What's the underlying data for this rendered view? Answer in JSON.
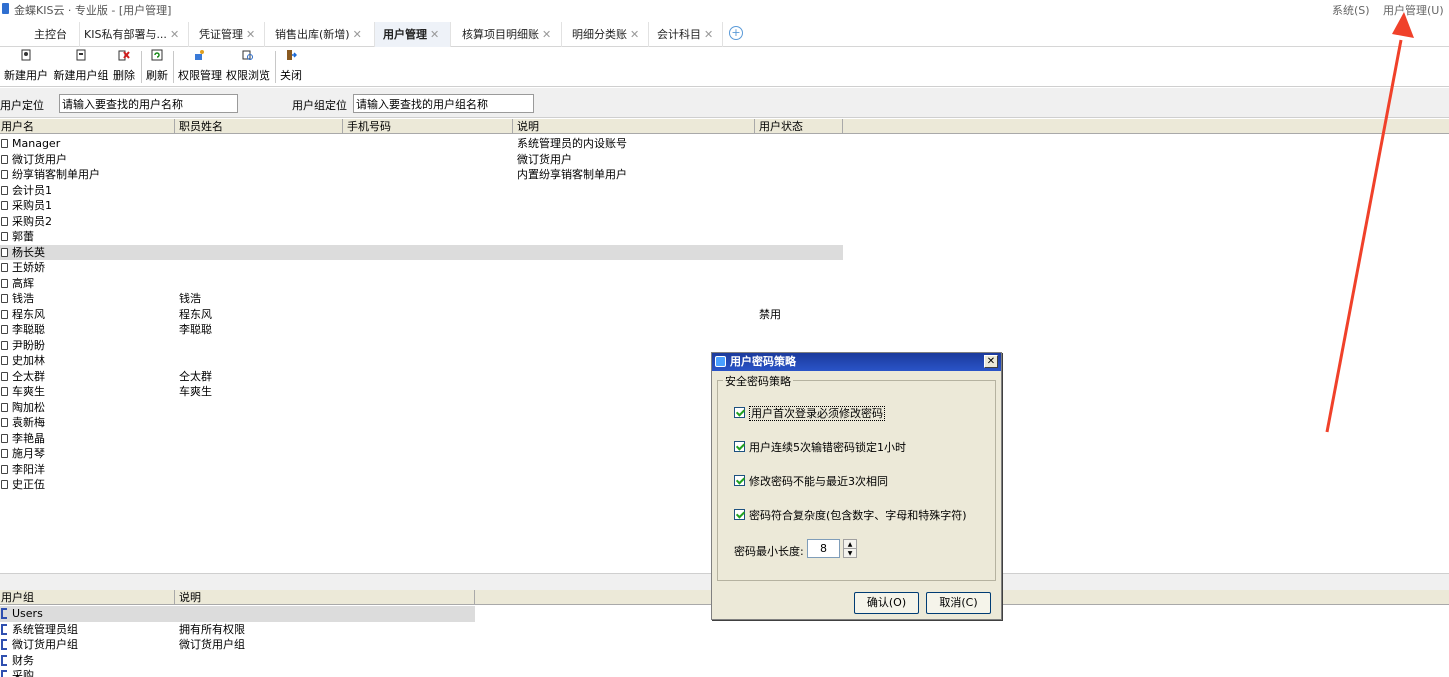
{
  "app": {
    "title": "金蝶KIS云 · 专业版 - [用户管理]",
    "menu_system": "系统(S)",
    "menu_user": "用户管理(U)"
  },
  "tabs": [
    {
      "label": "主控台",
      "closable": false
    },
    {
      "label": "KIS私有部署与...",
      "closable": true
    },
    {
      "label": "凭证管理",
      "closable": true
    },
    {
      "label": "销售出库(新增)",
      "closable": true
    },
    {
      "label": "用户管理",
      "closable": true,
      "active": true
    },
    {
      "label": "核算项目明细账",
      "closable": true
    },
    {
      "label": "明细分类账",
      "closable": true
    },
    {
      "label": "会计科目",
      "closable": true
    }
  ],
  "toolbar": {
    "new_user": "新建用户",
    "new_group": "新建用户组",
    "delete": "删除",
    "refresh": "刷新",
    "perm_manage": "权限管理",
    "perm_browse": "权限浏览",
    "close": "关闭"
  },
  "locator": {
    "user_label": "用户定位",
    "user_placeholder": "请输入要查找的用户名称",
    "group_label": "用户组定位",
    "group_placeholder": "请输入要查找的用户组名称"
  },
  "users_table": {
    "columns": [
      "用户名",
      "职员姓名",
      "手机号码",
      "说明",
      "用户状态"
    ],
    "rows": [
      {
        "name": "Manager",
        "employee": "",
        "phone": "",
        "desc": "系统管理员的内设账号",
        "status": ""
      },
      {
        "name": "微订货用户",
        "employee": "",
        "phone": "",
        "desc": "微订货用户",
        "status": ""
      },
      {
        "name": "纷享销客制单用户",
        "employee": "",
        "phone": "",
        "desc": "内置纷享销客制单用户",
        "status": ""
      },
      {
        "name": "会计员1",
        "employee": "",
        "phone": "",
        "desc": "",
        "status": ""
      },
      {
        "name": "采购员1",
        "employee": "",
        "phone": "",
        "desc": "",
        "status": ""
      },
      {
        "name": "采购员2",
        "employee": "",
        "phone": "",
        "desc": "",
        "status": ""
      },
      {
        "name": "郭蕾",
        "employee": "",
        "phone": "",
        "desc": "",
        "status": ""
      },
      {
        "name": "杨长英",
        "employee": "",
        "phone": "",
        "desc": "",
        "status": "",
        "selected": true
      },
      {
        "name": "王娇娇",
        "employee": "",
        "phone": "",
        "desc": "",
        "status": ""
      },
      {
        "name": "高辉",
        "employee": "",
        "phone": "",
        "desc": "",
        "status": ""
      },
      {
        "name": "钱浩",
        "employee": "钱浩",
        "phone": "",
        "desc": "",
        "status": ""
      },
      {
        "name": "程东风",
        "employee": "程东风",
        "phone": "",
        "desc": "",
        "status": "禁用"
      },
      {
        "name": "李聪聪",
        "employee": "李聪聪",
        "phone": "",
        "desc": "",
        "status": ""
      },
      {
        "name": "尹盼盼",
        "employee": "",
        "phone": "",
        "desc": "",
        "status": ""
      },
      {
        "name": "史加林",
        "employee": "",
        "phone": "",
        "desc": "",
        "status": ""
      },
      {
        "name": "仝太群",
        "employee": "仝太群",
        "phone": "",
        "desc": "",
        "status": ""
      },
      {
        "name": "车爽生",
        "employee": "车爽生",
        "phone": "",
        "desc": "",
        "status": ""
      },
      {
        "name": "陶加松",
        "employee": "",
        "phone": "",
        "desc": "",
        "status": ""
      },
      {
        "name": "袁新梅",
        "employee": "",
        "phone": "",
        "desc": "",
        "status": ""
      },
      {
        "name": "李艳晶",
        "employee": "",
        "phone": "",
        "desc": "",
        "status": ""
      },
      {
        "name": "施月琴",
        "employee": "",
        "phone": "",
        "desc": "",
        "status": ""
      },
      {
        "name": "李阳洋",
        "employee": "",
        "phone": "",
        "desc": "",
        "status": ""
      },
      {
        "name": "史正伍",
        "employee": "",
        "phone": "",
        "desc": "",
        "status": ""
      }
    ]
  },
  "groups_table": {
    "columns": [
      "用户组",
      "说明"
    ],
    "rows": [
      {
        "name": "Users",
        "desc": "",
        "selected": true
      },
      {
        "name": "系统管理员组",
        "desc": "拥有所有权限"
      },
      {
        "name": "微订货用户组",
        "desc": "微订货用户组"
      },
      {
        "name": "财务",
        "desc": ""
      },
      {
        "name": "采购",
        "desc": ""
      }
    ]
  },
  "dialog": {
    "title": "用户密码策略",
    "group_title": "安全密码策略",
    "options": [
      {
        "label": "用户首次登录必须修改密码",
        "checked": true
      },
      {
        "label": "用户连续5次输错密码锁定1小时",
        "checked": true
      },
      {
        "label": "修改密码不能与最近3次相同",
        "checked": true
      },
      {
        "label": "密码符合复杂度(包含数字、字母和特殊字符)",
        "checked": true
      }
    ],
    "min_length_label": "密码最小长度:",
    "min_length_value": "8",
    "ok": "确认(O)",
    "cancel": "取消(C)"
  },
  "colors": {
    "annotation_arrow": "#f0412a",
    "dialog_title_bg": "#2a54c8",
    "selected_row_bg": "#dcdcdc"
  }
}
